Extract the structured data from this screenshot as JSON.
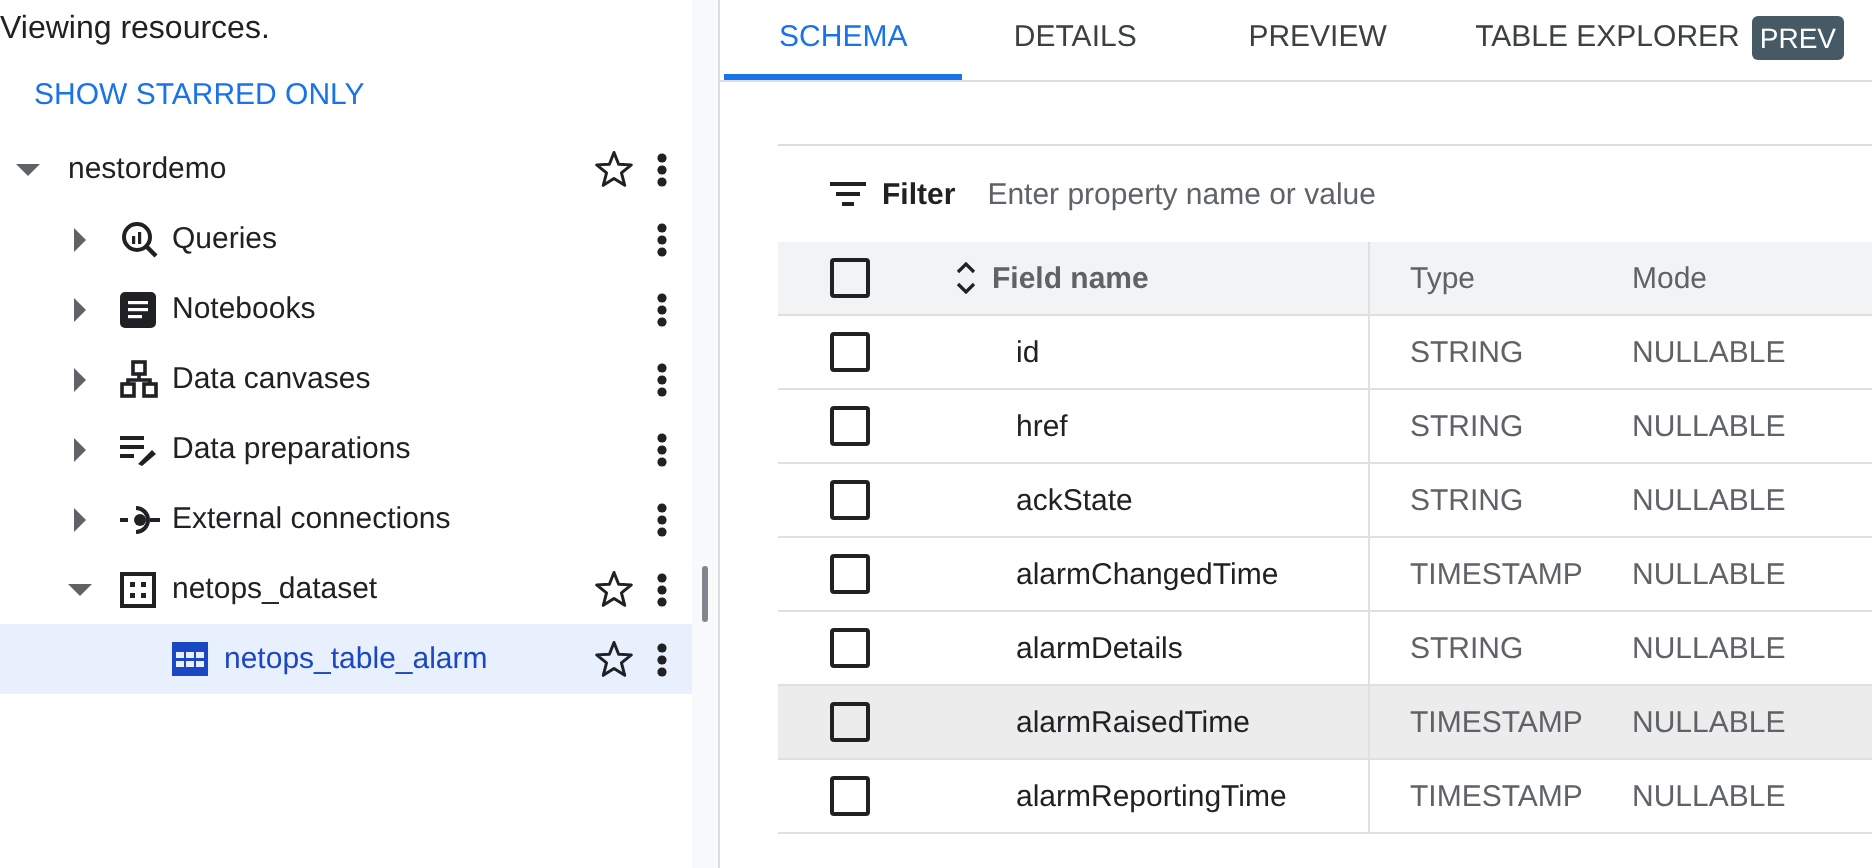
{
  "sidebar": {
    "status": "Viewing resources.",
    "starred_link": "SHOW STARRED ONLY",
    "tree": [
      {
        "label": "nestordemo",
        "kind": "project",
        "expanded": true,
        "star": true,
        "selected": false,
        "children": [
          {
            "label": "Queries",
            "kind": "query",
            "expanded": false,
            "star": false,
            "selected": false
          },
          {
            "label": "Notebooks",
            "kind": "notebook",
            "expanded": false,
            "star": false,
            "selected": false
          },
          {
            "label": "Data canvases",
            "kind": "canvas",
            "expanded": false,
            "star": false,
            "selected": false
          },
          {
            "label": "Data preparations",
            "kind": "prep",
            "expanded": false,
            "star": false,
            "selected": false
          },
          {
            "label": "External connections",
            "kind": "connection",
            "expanded": false,
            "star": false,
            "selected": false
          },
          {
            "label": "netops_dataset",
            "kind": "dataset",
            "expanded": true,
            "star": true,
            "selected": false,
            "children": [
              {
                "label": "netops_table_alarm",
                "kind": "table",
                "star": true,
                "selected": true
              }
            ]
          }
        ]
      }
    ]
  },
  "tabs": [
    {
      "label": "SCHEMA",
      "selected": true
    },
    {
      "label": "DETAILS",
      "selected": false
    },
    {
      "label": "PREVIEW",
      "selected": false
    },
    {
      "label": "TABLE EXPLORER",
      "selected": false,
      "badge": "PREV"
    }
  ],
  "filter": {
    "label": "Filter",
    "placeholder": "Enter property name or value"
  },
  "table": {
    "columns": [
      "Field name",
      "Type",
      "Mode"
    ],
    "all_checked": false,
    "rows": [
      {
        "name": "id",
        "type": "STRING",
        "mode": "NULLABLE",
        "checked": false,
        "highlighted": false
      },
      {
        "name": "href",
        "type": "STRING",
        "mode": "NULLABLE",
        "checked": false,
        "highlighted": false
      },
      {
        "name": "ackState",
        "type": "STRING",
        "mode": "NULLABLE",
        "checked": false,
        "highlighted": false
      },
      {
        "name": "alarmChangedTime",
        "type": "TIMESTAMP",
        "mode": "NULLABLE",
        "checked": false,
        "highlighted": false
      },
      {
        "name": "alarmDetails",
        "type": "STRING",
        "mode": "NULLABLE",
        "checked": false,
        "highlighted": false
      },
      {
        "name": "alarmRaisedTime",
        "type": "TIMESTAMP",
        "mode": "NULLABLE",
        "checked": false,
        "highlighted": true
      },
      {
        "name": "alarmReportingTime",
        "type": "TIMESTAMP",
        "mode": "NULLABLE",
        "checked": false,
        "highlighted": false
      }
    ]
  }
}
